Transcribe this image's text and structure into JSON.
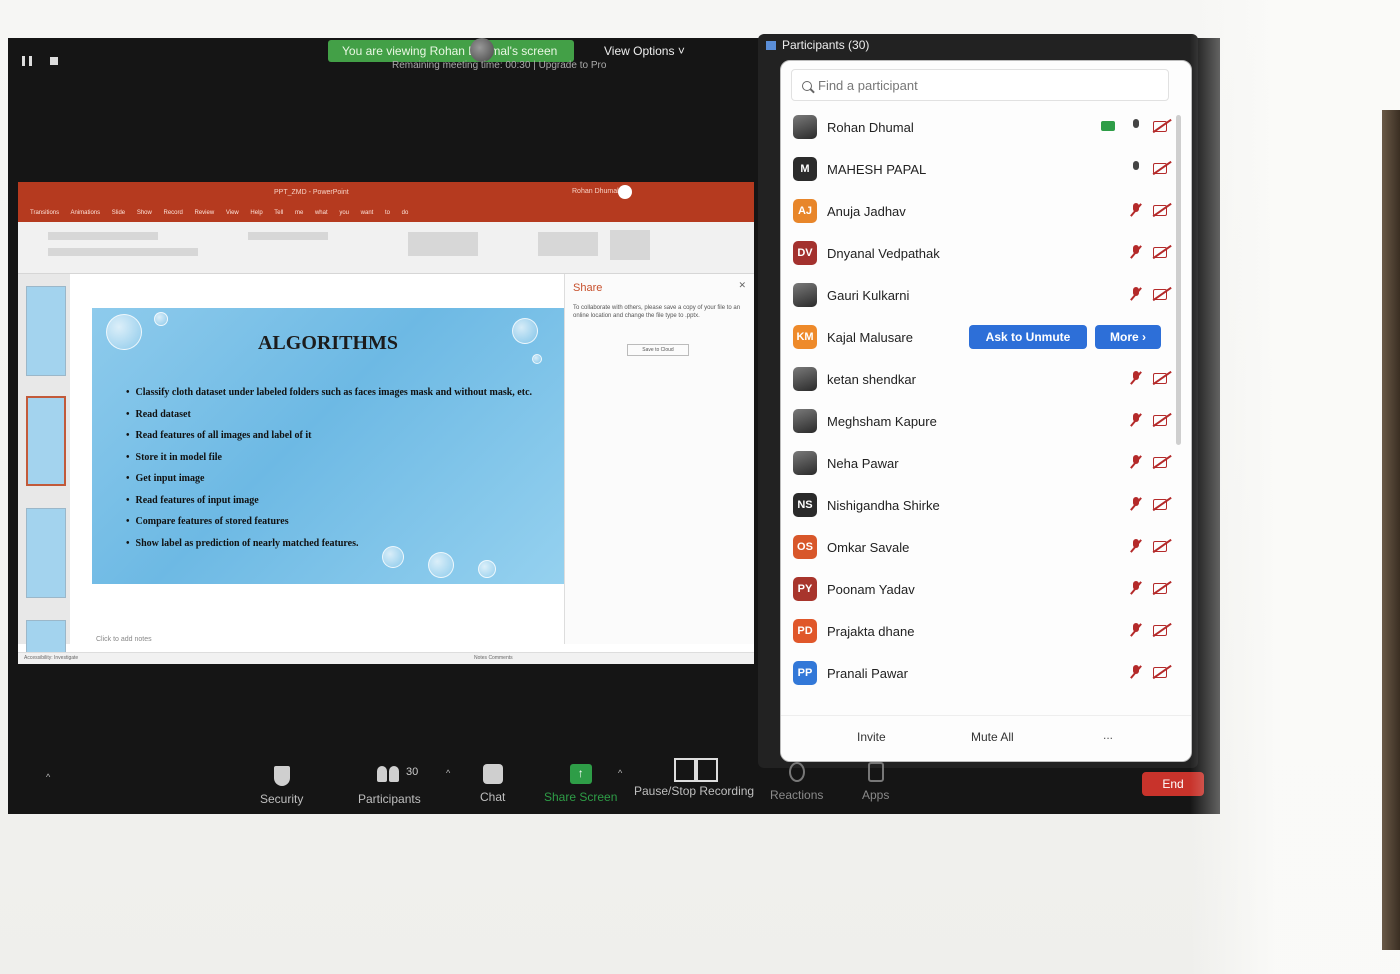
{
  "top_bar": {
    "viewing_banner": "You are viewing Rohan Dhumal's screen",
    "view_options": "View Options ˅",
    "remaining": "Remaining meeting time: 00:30 | Upgrade to Pro"
  },
  "ppt": {
    "title": "PPT_ZMD - PowerPoint",
    "user": "Rohan Dhumal",
    "tabs": "Transitions Animations Slide Show Record Review View Help Tell me what you want to do",
    "slide_title": "ALGORITHMS",
    "bullets": [
      "Classify cloth dataset under labeled folders such as faces images mask and without mask, etc.",
      "Read dataset",
      "Read features of all images and label of it",
      "Store it in model file",
      "Get input image",
      "Read features of input image",
      "Compare features of stored features",
      "Show label as prediction of nearly matched features."
    ],
    "share_pane_title": "Share",
    "share_pane_text": "To collaborate with others, please save a copy of your file to an online location and change the file type to .pptx.",
    "share_pane_button": "Save to Cloud",
    "notes": "Click to add notes",
    "status_left": "Accessibility: Investigate",
    "status_right": "Notes  Comments"
  },
  "participants_panel": {
    "title": "Participants (30)",
    "search_placeholder": "Find a participant",
    "participants": [
      {
        "name": "Rohan Dhumal",
        "initials": "",
        "color": "#555555"
      },
      {
        "name": "MAHESH PAPAL",
        "initials": "M",
        "color": "#2b2b2b"
      },
      {
        "name": "Anuja Jadhav",
        "initials": "AJ",
        "color": "#e8862a"
      },
      {
        "name": "Dnyanal Vedpathak",
        "initials": "DV",
        "color": "#a3312e"
      },
      {
        "name": "Gauri Kulkarni",
        "initials": "",
        "color": "#666666"
      },
      {
        "name": "Kajal Malusare",
        "initials": "KM",
        "color": "#ee8a2a"
      },
      {
        "name": "ketan shendkar",
        "initials": "",
        "color": "#3d4a72"
      },
      {
        "name": "Meghsham Kapure",
        "initials": "",
        "color": "#2a2a2a"
      },
      {
        "name": "Neha Pawar",
        "initials": "",
        "color": "#333333"
      },
      {
        "name": "Nishigandha Shirke",
        "initials": "NS",
        "color": "#2a2a2a"
      },
      {
        "name": "Omkar Savale",
        "initials": "OS",
        "color": "#d8572a"
      },
      {
        "name": "Poonam Yadav",
        "initials": "PY",
        "color": "#a8352c"
      },
      {
        "name": "Prajakta dhane",
        "initials": "PD",
        "color": "#e0572a"
      },
      {
        "name": "Pranali Pawar",
        "initials": "PP",
        "color": "#3278d8"
      }
    ],
    "ask_to_unmute": "Ask to Unmute",
    "more": "More ›",
    "invite": "Invite",
    "mute_all": "Mute All",
    "footer_more": "..."
  },
  "toolbar": {
    "security": "Security",
    "participants": "Participants",
    "participants_count": "30",
    "chat": "Chat",
    "share_screen": "Share Screen",
    "pause_stop": "Pause/Stop Recording",
    "reactions": "Reactions",
    "apps": "Apps",
    "end": "End"
  },
  "colors": {
    "green_banner": "#43a047",
    "ppt_red": "#b53a1f",
    "zoom_blue": "#2d6fd8",
    "end_red": "#c8332b"
  }
}
